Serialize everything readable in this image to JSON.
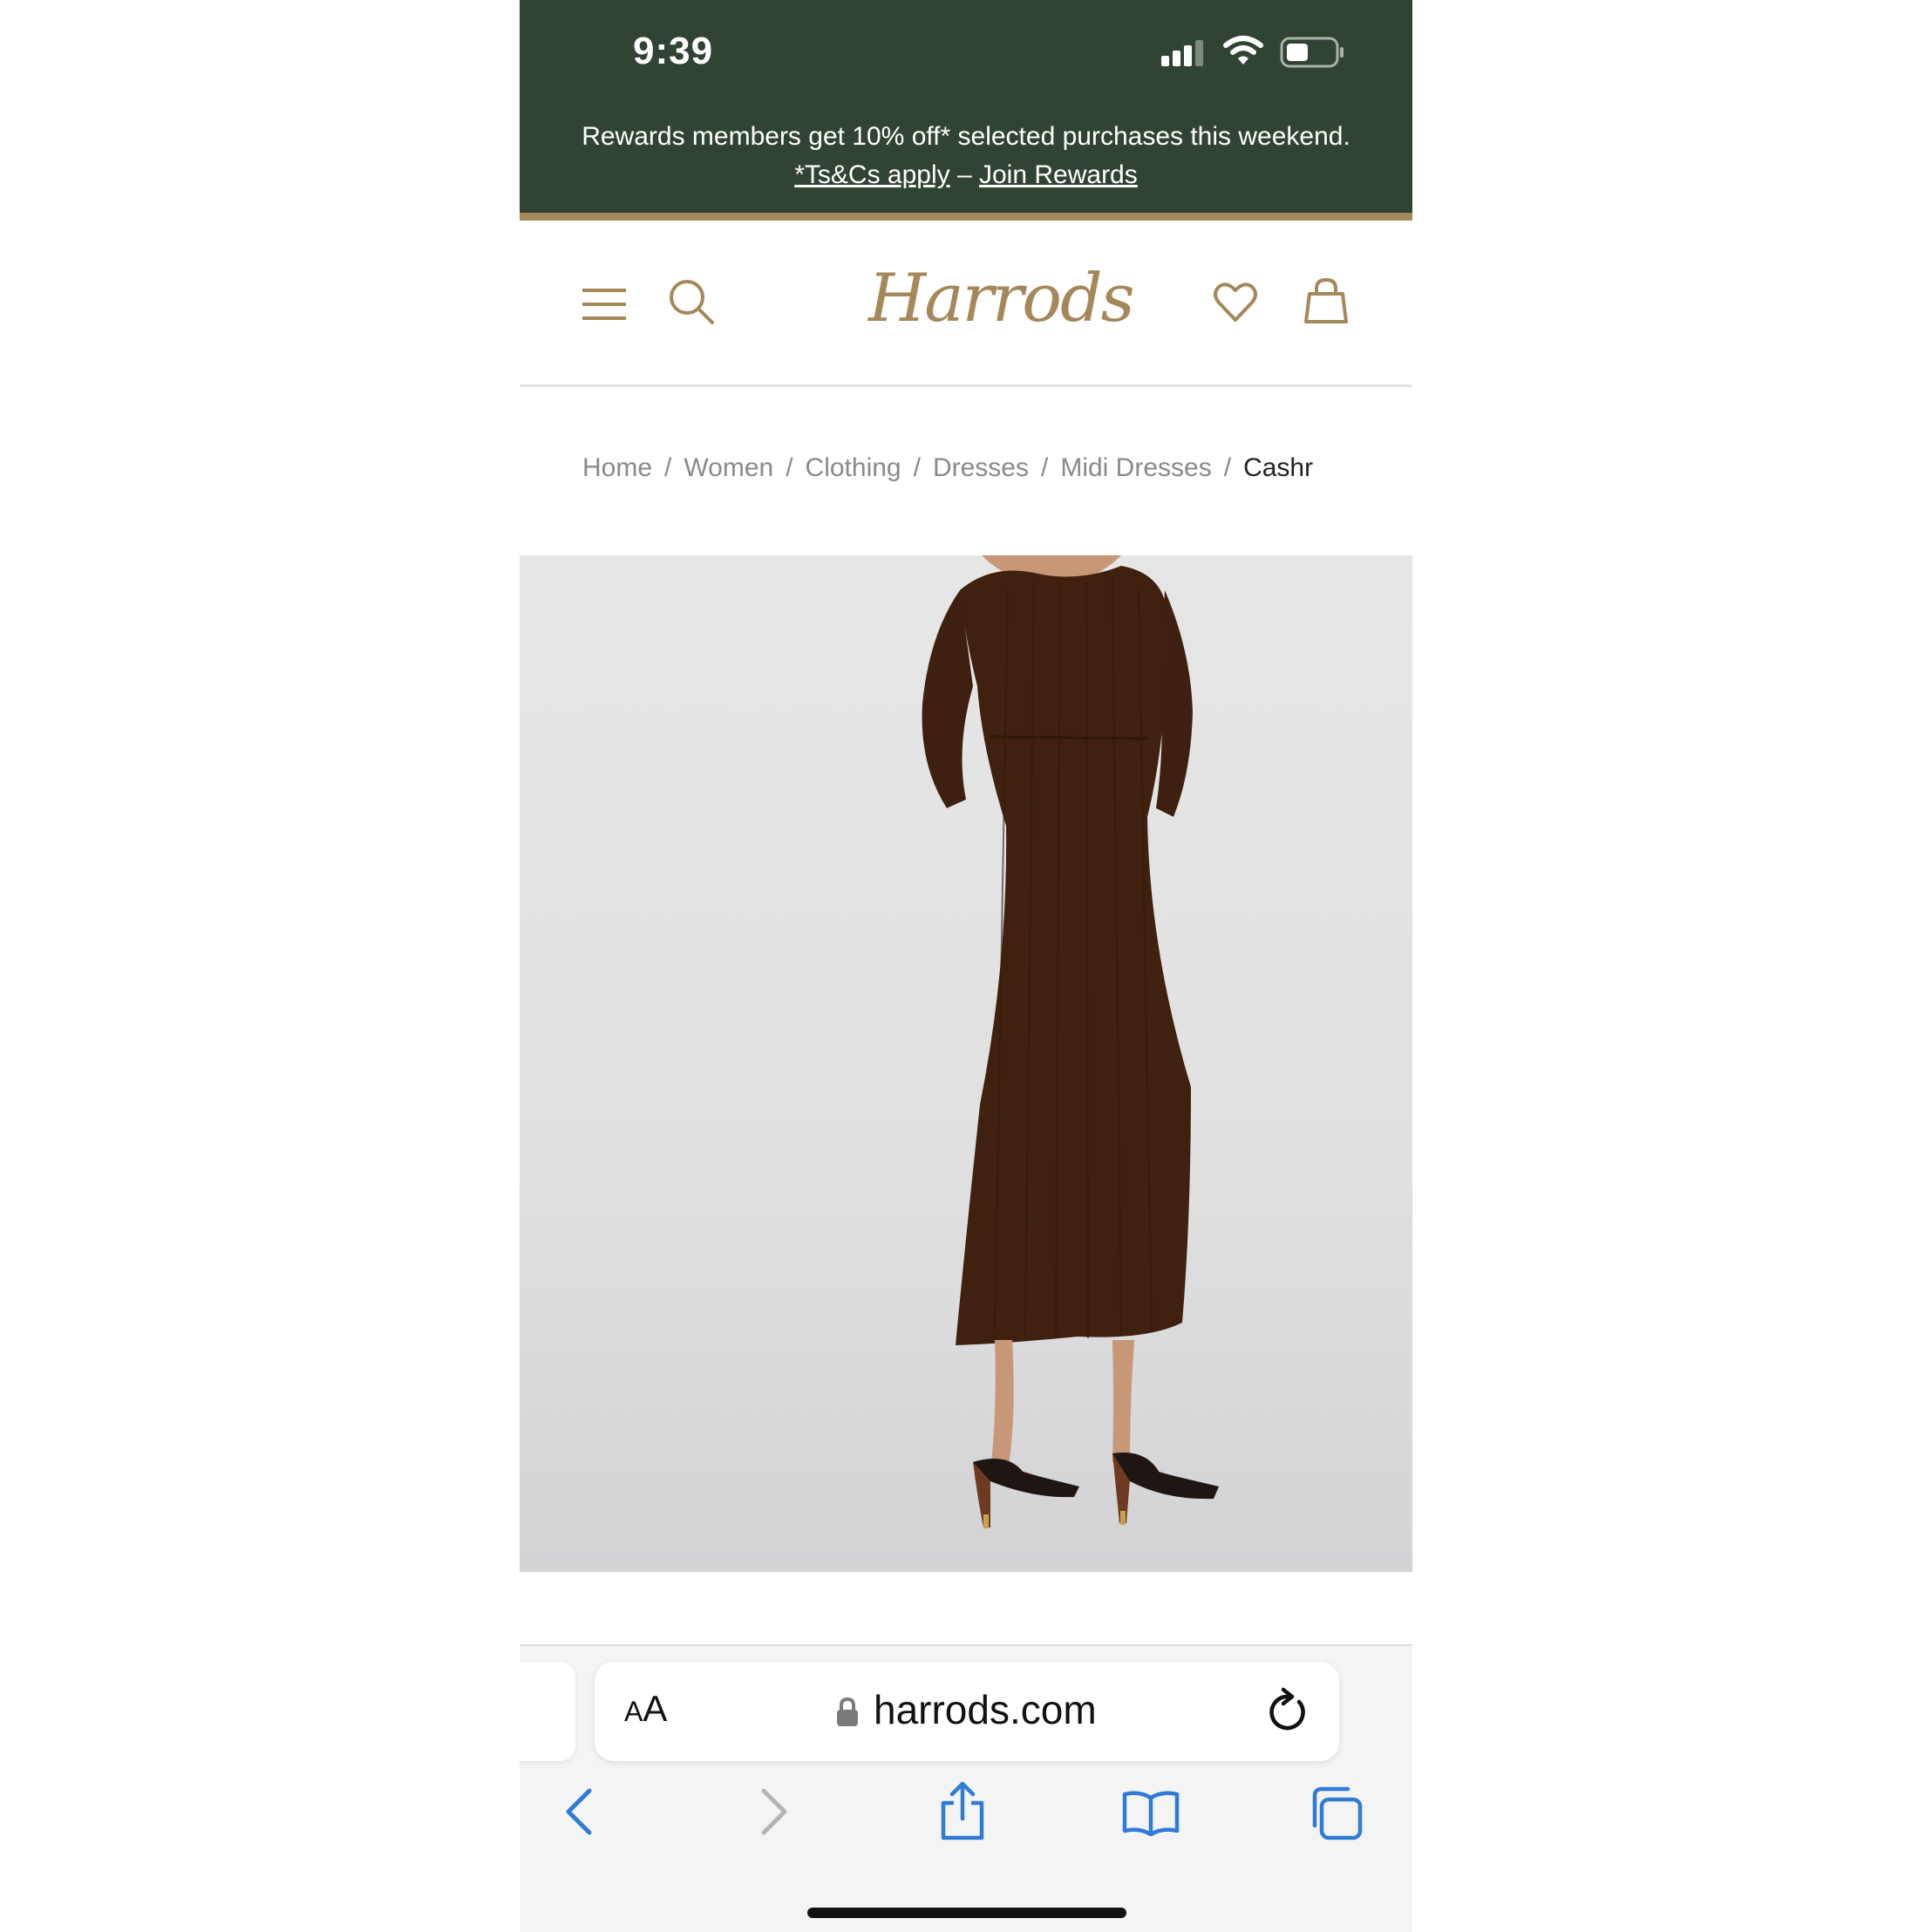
{
  "status_bar": {
    "time": "9:39"
  },
  "promo": {
    "message": "Rewards members get 10% off* selected purchases this weekend.",
    "terms_link": "*Ts&Cs apply",
    "separator": " – ",
    "join_link": "Join Rewards"
  },
  "header": {
    "logo": "Harrods",
    "menu_icon": "menu-icon",
    "search_icon": "search-icon",
    "wishlist_icon": "heart-icon",
    "bag_icon": "bag-icon"
  },
  "breadcrumb": {
    "items": [
      "Home",
      "Women",
      "Clothing",
      "Dresses",
      "Midi Dresses"
    ],
    "separator": "/",
    "current": "Cashr"
  },
  "browser": {
    "text_size_small": "A",
    "text_size_large": "A",
    "url": "harrods.com"
  },
  "colors": {
    "banner_green": "#314434",
    "brand_gold": "#a4885a",
    "ios_blue": "#2f7bd6"
  }
}
